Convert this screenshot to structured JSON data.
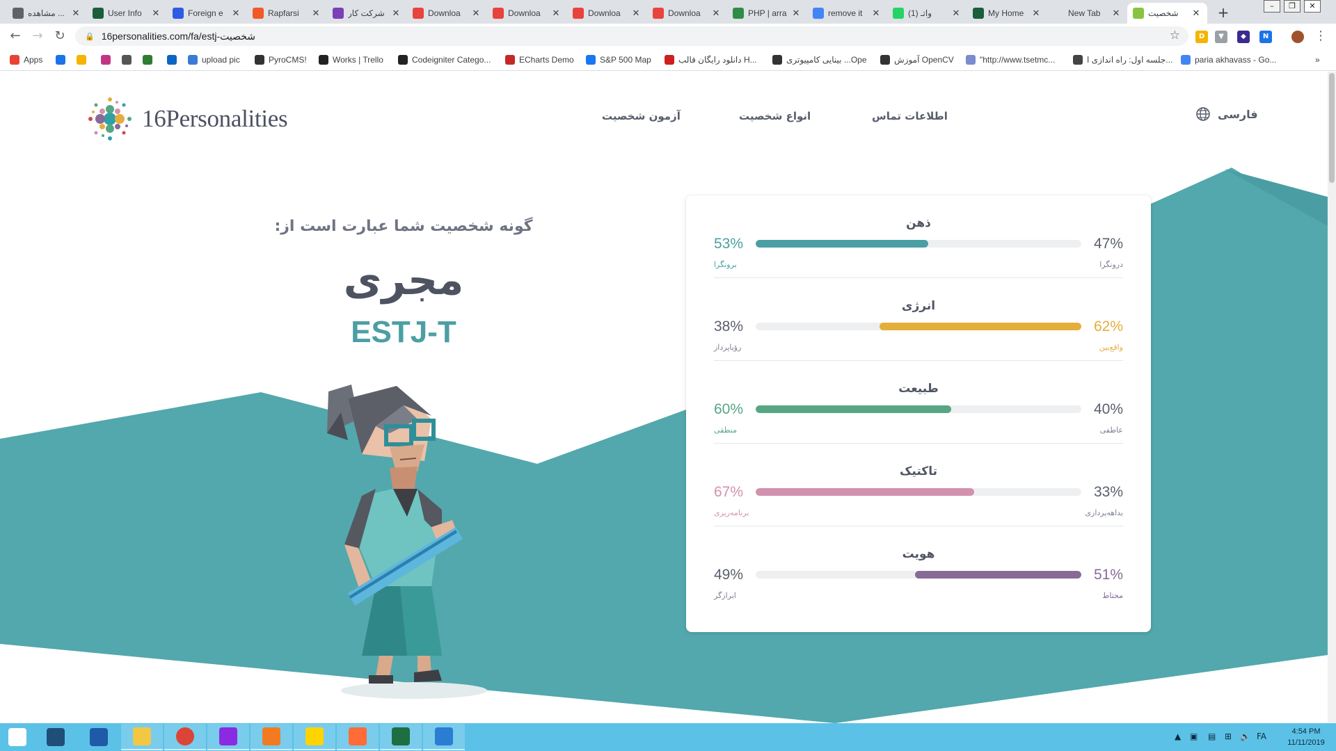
{
  "browser": {
    "tabs": [
      {
        "title": "مشاهده ...",
        "color": "#5f6368"
      },
      {
        "title": "User Info",
        "color": "#1a5e3a"
      },
      {
        "title": "Foreign e",
        "color": "#2d5be3"
      },
      {
        "title": "Rapfarsi",
        "color": "#f05a28"
      },
      {
        "title": "شرکت کار",
        "color": "#7b3fb8"
      },
      {
        "title": "Downloa",
        "color": "#e8433d"
      },
      {
        "title": "Downloa",
        "color": "#e8433d"
      },
      {
        "title": "Downloa",
        "color": "#e8433d"
      },
      {
        "title": "Downloa",
        "color": "#e8433d"
      },
      {
        "title": "PHP | arra",
        "color": "#2f8d46"
      },
      {
        "title": "remove it",
        "color": "#4285f4"
      },
      {
        "title": "(1) واتـ",
        "color": "#25d366"
      },
      {
        "title": "My Home",
        "color": "#1a5e3a"
      },
      {
        "title": "New Tab",
        "color": ""
      },
      {
        "title": "شخصیت",
        "color": "#8ac33f"
      }
    ],
    "url": "16personalities.com/fa/estj-شخصیت",
    "bookmarks": [
      {
        "label": "Apps",
        "color": "#e94235"
      },
      {
        "label": "",
        "color": "#1a73e8"
      },
      {
        "label": "",
        "color": "#f4b400"
      },
      {
        "label": "",
        "color": "#c13584"
      },
      {
        "label": "",
        "color": "#555555"
      },
      {
        "label": "",
        "color": "#2e7d32"
      },
      {
        "label": "",
        "color": "#0a66c2"
      },
      {
        "label": "upload pic",
        "color": "#3a7bd5"
      },
      {
        "label": "PyroCMS!",
        "color": "#333333"
      },
      {
        "label": "Works | Trello",
        "color": "#222222"
      },
      {
        "label": "Codeigniter Catego...",
        "color": "#222222"
      },
      {
        "label": "ECharts Demo",
        "color": "#c62828"
      },
      {
        "label": "S&P 500 Map",
        "color": "#1877f2"
      },
      {
        "label": "دانلود رایگان قالب H...",
        "color": "#cc1f1f"
      },
      {
        "label": "بینایی کامپیوتری ...Ope",
        "color": "#333333"
      },
      {
        "label": "آموزش OpenCV",
        "color": "#333333"
      },
      {
        "label": "\"http://www.tsetmc...",
        "color": "#7a8bd0"
      },
      {
        "label": "جلسه اول: راه اندازی ا...",
        "color": "#444444"
      },
      {
        "label": "paria akhavass - Go...",
        "color": "#4285f4"
      }
    ]
  },
  "site": {
    "logo_text": "16Personalities",
    "nav": {
      "test": "آزمون شخصیت",
      "types": "انواع شخصیت",
      "contact": "اطلاعات تماس",
      "language": "فارسی"
    }
  },
  "result": {
    "intro": "گونه شخصیت شما عبارت است از:",
    "type_name": "مجری",
    "type_code": "ESTJ-T"
  },
  "traits": [
    {
      "title": "ذهن",
      "left_pct": "53%",
      "left_label": "برونگرا",
      "right_pct": "47%",
      "right_label": "درونگرا",
      "fill_side": "left",
      "fill_fraction": 0.53,
      "color": "#4a9fa4"
    },
    {
      "title": "انرژی",
      "left_pct": "38%",
      "left_label": "رؤیاپرداز",
      "right_pct": "62%",
      "right_label": "واقع‌بین",
      "fill_side": "right",
      "fill_fraction": 0.62,
      "color": "#e4ae3a"
    },
    {
      "title": "طبیعت",
      "left_pct": "60%",
      "left_label": "منطقی",
      "right_pct": "40%",
      "right_label": "عاطفی",
      "fill_side": "left",
      "fill_fraction": 0.6,
      "color": "#56a683"
    },
    {
      "title": "تاکتیک",
      "left_pct": "67%",
      "left_label": "برنامه‌ریزی",
      "right_pct": "33%",
      "right_label": "بداهه‌پردازی",
      "fill_side": "left",
      "fill_fraction": 0.67,
      "color": "#d291ae"
    },
    {
      "title": "هویت",
      "left_pct": "49%",
      "left_label": "ابرازگر",
      "right_pct": "51%",
      "right_label": "محتاط",
      "fill_side": "right",
      "fill_fraction": 0.51,
      "color": "#886a97"
    }
  ],
  "taskbar": {
    "time": "4:54 PM",
    "date": "11/11/2019",
    "lang": "FA",
    "apps": [
      {
        "name": "windows-start",
        "color": "#ffffff"
      },
      {
        "name": "task-view",
        "color": "#1f4e79"
      },
      {
        "name": "powershell",
        "color": "#1e5aa8"
      },
      {
        "name": "file-explorer",
        "color": "#f2c744"
      },
      {
        "name": "chrome",
        "color": "#db4437"
      },
      {
        "name": "phpstorm",
        "color": "#8a2be2"
      },
      {
        "name": "eclipse",
        "color": "#f27b22"
      },
      {
        "name": "sticky-notes",
        "color": "#ffd400"
      },
      {
        "name": "postman",
        "color": "#ff6c37"
      },
      {
        "name": "excel",
        "color": "#1d6f42"
      },
      {
        "name": "outlook",
        "color": "#2b7cd3"
      }
    ]
  }
}
